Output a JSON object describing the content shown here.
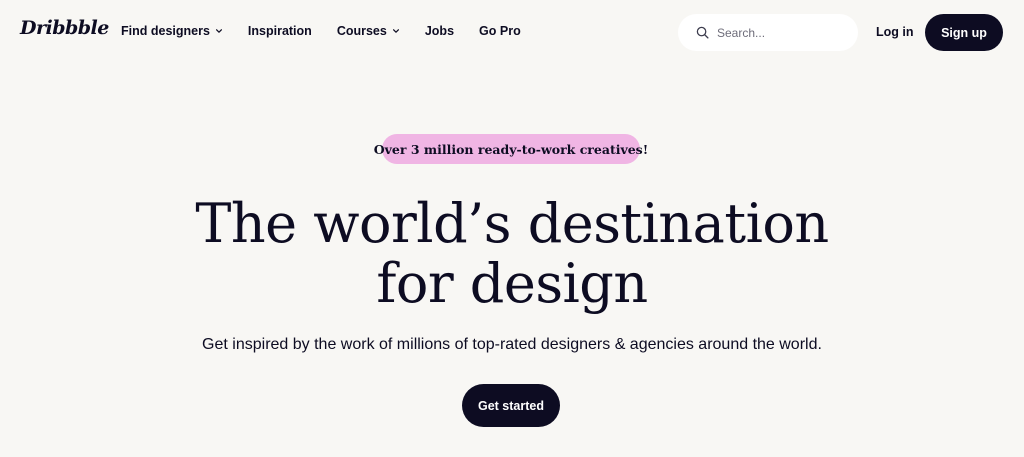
{
  "header": {
    "logo_text": "Dribbble",
    "nav": [
      {
        "label": "Find designers",
        "has_dropdown": true
      },
      {
        "label": "Inspiration",
        "has_dropdown": false
      },
      {
        "label": "Courses",
        "has_dropdown": true
      },
      {
        "label": "Jobs",
        "has_dropdown": false
      },
      {
        "label": "Go Pro",
        "has_dropdown": false
      }
    ],
    "search": {
      "placeholder": "Search..."
    },
    "login_label": "Log in",
    "signup_label": "Sign up"
  },
  "hero": {
    "badge": "Over 3 million ready-to-work creatives!",
    "title_line1": "The world’s destination",
    "title_line2": "for design",
    "subtitle": "Get inspired by the work of millions of top-rated designers & agencies around the world.",
    "cta_label": "Get started"
  },
  "colors": {
    "background": "#f8f7f4",
    "text": "#0d0c22",
    "badge_bg": "#f0b5e4",
    "button_bg": "#0d0c22",
    "button_text": "#ffffff"
  },
  "icons": {
    "search": "search-icon",
    "dropdown": "chevron-down-icon"
  }
}
